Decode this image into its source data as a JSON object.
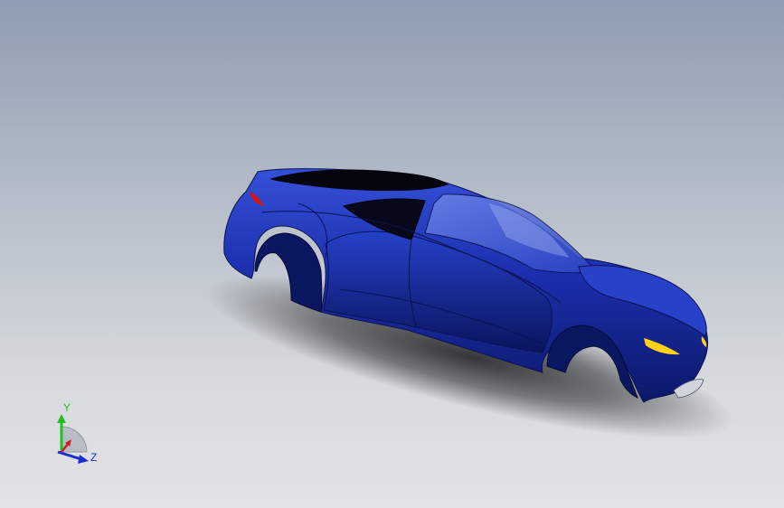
{
  "viewport": {
    "model": "car-body",
    "body_color": "#1a2fa8",
    "background_top": "#8e9db1",
    "background_bottom": "#e2e3e5"
  },
  "triad": {
    "y_label": "Y",
    "z_label": "Z",
    "y_color": "#22c022",
    "z_color": "#1a2fd0",
    "x_color": "#cc2020"
  }
}
